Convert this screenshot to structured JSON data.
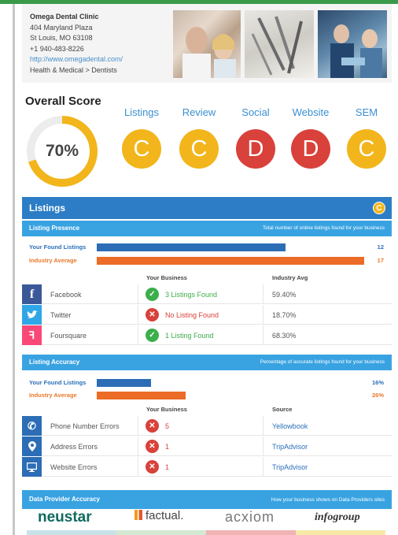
{
  "clinic": {
    "name": "Omega Dental Clinic",
    "address1": "404 Maryland Plaza",
    "address2": "St Louis, MO 63108",
    "phone": "+1 940-483-8226",
    "url": "http://www.omegadental.com/",
    "category": "Health & Medical > Dentists"
  },
  "overall": {
    "title": "Overall Score",
    "score": "70%",
    "score_value": 70,
    "categories": [
      {
        "label": "Listings",
        "grade": "C",
        "color": "#f2b51b"
      },
      {
        "label": "Review",
        "grade": "C",
        "color": "#f2b51b"
      },
      {
        "label": "Social",
        "grade": "D",
        "color": "#d9413b"
      },
      {
        "label": "Website",
        "grade": "D",
        "color": "#d9413b"
      },
      {
        "label": "SEM",
        "grade": "C",
        "color": "#f2b51b"
      }
    ]
  },
  "listings": {
    "title": "Listings",
    "badge": "C",
    "presence": {
      "title": "Listing Presence",
      "description": "Total number of online listings found for your business",
      "your_label": "Your Found Listings",
      "your_value": "12",
      "your_fraction": 0.706,
      "avg_label": "Industry Average",
      "avg_value": "17",
      "avg_fraction": 1.0,
      "col_business": "Your Business",
      "col_avg": "Industry Avg",
      "rows": [
        {
          "name": "Facebook",
          "status": "3 Listings Found",
          "ok": true,
          "avg": "59.40%"
        },
        {
          "name": "Twitter",
          "status": "No Listing Found",
          "ok": false,
          "avg": "18.70%"
        },
        {
          "name": "Foursquare",
          "status": "1 Listing Found",
          "ok": true,
          "avg": "68.30%"
        }
      ]
    },
    "accuracy": {
      "title": "Listing Accuracy",
      "description": "Percentage of accurate listings found for your business",
      "your_label": "Your Found Listings",
      "your_value": "16%",
      "your_fraction": 0.16,
      "avg_label": "Industry Average",
      "avg_value": "26%",
      "avg_fraction": 0.26,
      "col_business": "Your Business",
      "col_source": "Source",
      "rows": [
        {
          "name": "Phone Number Errors",
          "count": "5",
          "source": "Yellowbook"
        },
        {
          "name": "Address Errors",
          "count": "1",
          "source": "TripAdvisor"
        },
        {
          "name": "Website Errors",
          "count": "1",
          "source": "TripAdvisor"
        }
      ]
    }
  },
  "providers": {
    "title": "Data Provider Accuracy",
    "description": "How your business shows on Data Providers sites",
    "logos": [
      "neustar",
      "factual.",
      "acxiom",
      "infogroup"
    ]
  }
}
